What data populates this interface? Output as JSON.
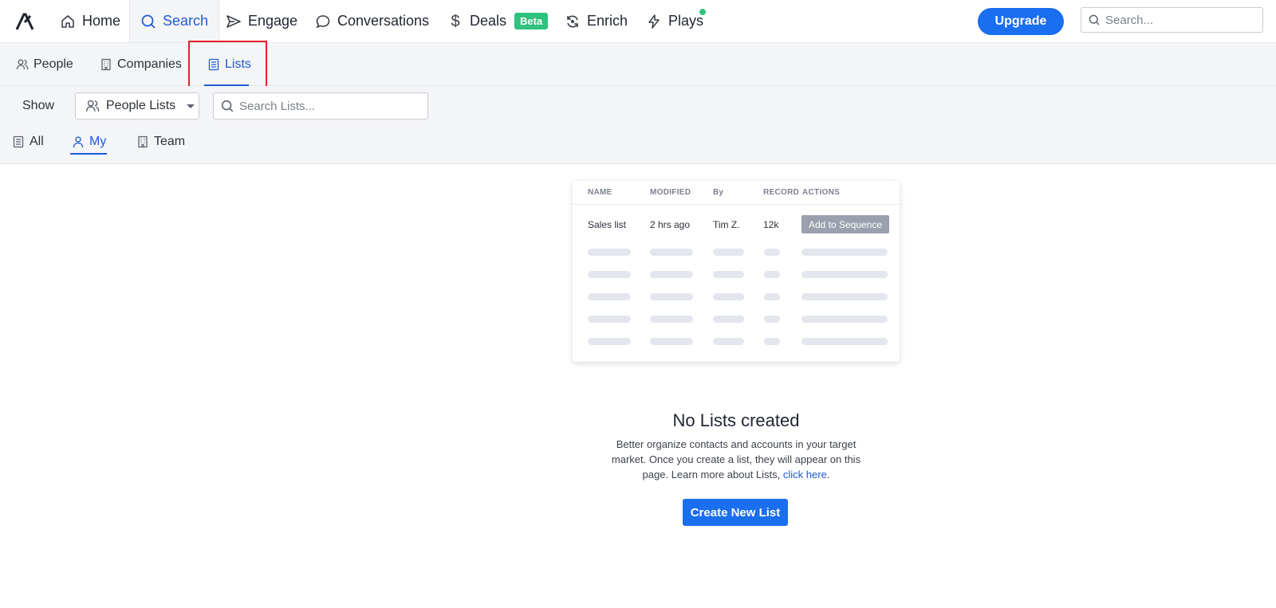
{
  "topnav": {
    "items": [
      {
        "label": "Home",
        "icon": "home-icon"
      },
      {
        "label": "Search",
        "icon": "search-icon",
        "active": true
      },
      {
        "label": "Engage",
        "icon": "send-icon"
      },
      {
        "label": "Conversations",
        "icon": "chat-bubble-icon"
      },
      {
        "label": "Deals",
        "icon": "dollar-icon",
        "badge": "Beta"
      },
      {
        "label": "Enrich",
        "icon": "refresh-icon"
      },
      {
        "label": "Plays",
        "icon": "lightning-icon"
      }
    ],
    "upgrade_label": "Upgrade",
    "search_placeholder": "Search...",
    "accent_color": "#1a6ef0",
    "badge_color": "#2ec27e"
  },
  "subnav": {
    "tabs": [
      {
        "label": "People",
        "icon": "people-icon"
      },
      {
        "label": "Companies",
        "icon": "building-icon"
      },
      {
        "label": "Lists",
        "icon": "list-icon",
        "active": true
      }
    ]
  },
  "filters": {
    "show_label": "Show",
    "list_type_value": "People Lists",
    "search_placeholder": "Search Lists...",
    "scopes": [
      {
        "label": "All",
        "icon": "document-icon"
      },
      {
        "label": "My",
        "icon": "user-icon",
        "active": true
      },
      {
        "label": "Team",
        "icon": "building-icon"
      }
    ]
  },
  "preview": {
    "headers": [
      "NAME",
      "MODIFIED",
      "By",
      "RECORD",
      "ACTIONS"
    ],
    "row": {
      "name": "Sales list",
      "modified": "2 hrs ago",
      "by": "Tim Z.",
      "record": "12k",
      "action": "Add to Sequence"
    }
  },
  "empty_state": {
    "title": "No Lists created",
    "description": "Better organize contacts and accounts in your target market. Once you create a list, they will appear on this page. Learn more about Lists,",
    "link_label": "click here",
    "trailing": ".",
    "button_label": "Create New List"
  }
}
